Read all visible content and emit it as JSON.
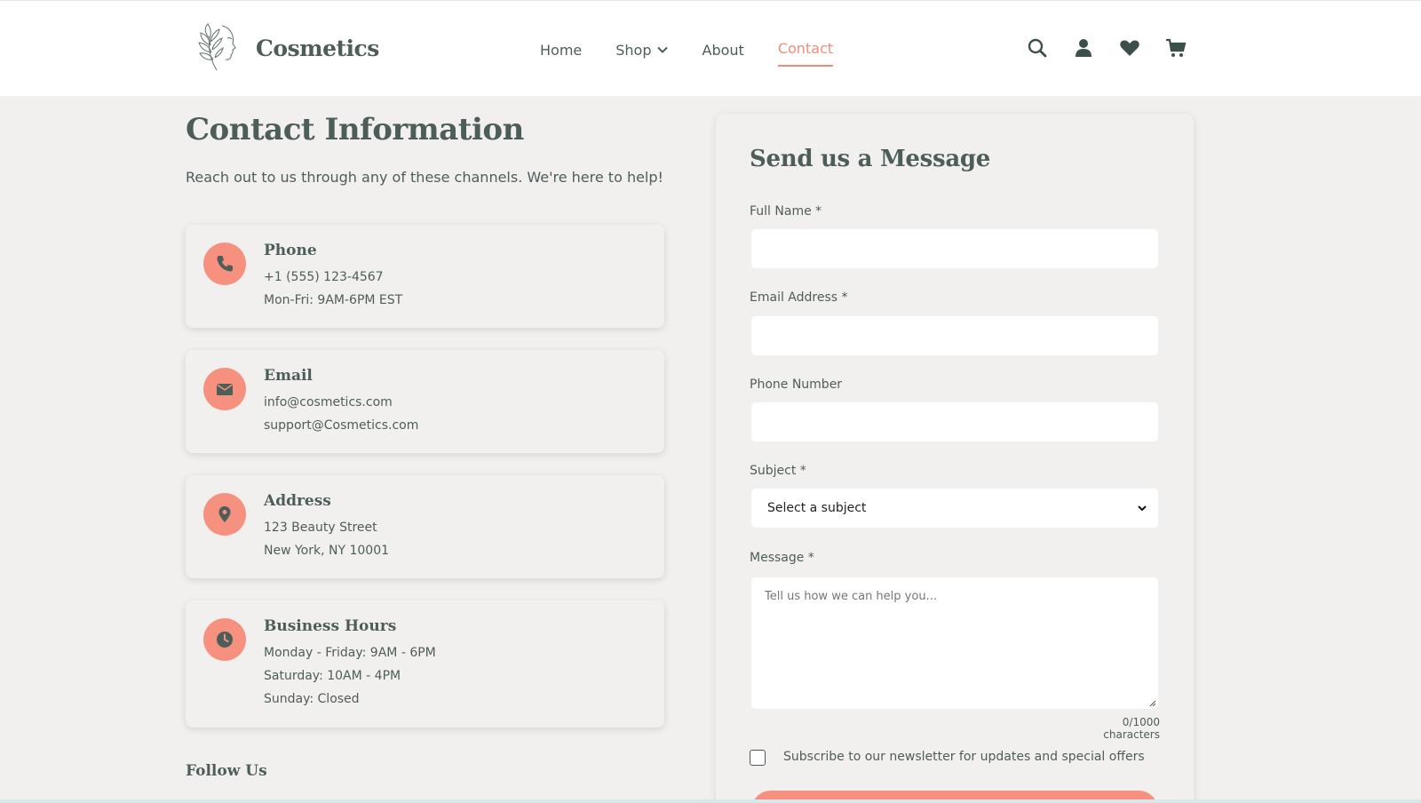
{
  "brand": {
    "name": "Cosmetics"
  },
  "nav": {
    "items": [
      {
        "label": "Home"
      },
      {
        "label": "Shop"
      },
      {
        "label": "About"
      },
      {
        "label": "Contact"
      }
    ],
    "active": "Contact"
  },
  "header_icons": [
    "search-icon",
    "user-icon",
    "heart-icon",
    "cart-icon"
  ],
  "contact": {
    "title": "Contact Information",
    "subtitle": "Reach out to us through any of these channels. We're here to help!",
    "cards": [
      {
        "icon": "phone-icon",
        "title": "Phone",
        "lines": [
          "+1 (555) 123-4567",
          "Mon-Fri: 9AM-6PM EST"
        ]
      },
      {
        "icon": "envelope-icon",
        "title": "Email",
        "lines": [
          "info@cosmetics.com",
          "support@Cosmetics.com"
        ]
      },
      {
        "icon": "map-pin-icon",
        "title": "Address",
        "lines": [
          "123 Beauty Street",
          "New York, NY 10001"
        ]
      },
      {
        "icon": "clock-icon",
        "title": "Business Hours",
        "lines": [
          "Monday - Friday: 9AM - 6PM",
          "Saturday: 10AM - 4PM",
          "Sunday: Closed"
        ]
      }
    ],
    "follow_title": "Follow Us"
  },
  "form": {
    "title": "Send us a Message",
    "full_name_label": "Full Name *",
    "full_name_value": "",
    "email_label": "Email Address *",
    "email_value": "",
    "phone_label": "Phone Number",
    "phone_value": "",
    "subject_label": "Subject *",
    "subject_value": "Select a subject",
    "message_label": "Message *",
    "message_placeholder": "Tell us how we can help you...",
    "char_count": "0/1000 characters",
    "newsletter_label": "Subscribe to our newsletter for updates and special offers",
    "newsletter_checked": false
  },
  "colors": {
    "accent": "#f6907f",
    "text": "#4d5e5a",
    "background": "#f2f0ee"
  }
}
